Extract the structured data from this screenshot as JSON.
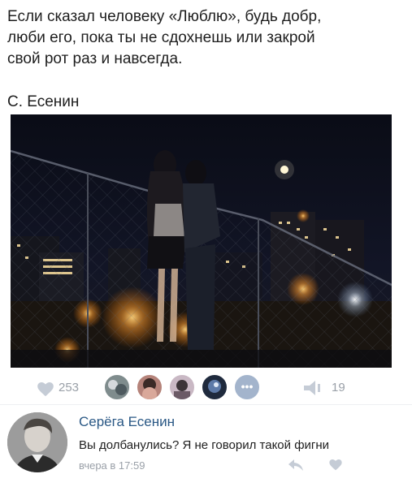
{
  "post": {
    "text_lines": [
      "Если сказал человеку «Люблю», будь добр,",
      "люби его, пока ты не сдохнешь или закрой",
      "свой рот раз и навсегда."
    ],
    "author": "С. Есенин"
  },
  "actions": {
    "like_count": "253",
    "repost_count": "19",
    "more_avatars_label": "•••"
  },
  "comment": {
    "name": "Серёга Есенин",
    "text": "Вы долбанулись? Я не говорил такой фигни",
    "time": "вчера в 17:59"
  },
  "colors": {
    "link": "#2a5885",
    "muted": "#9aa0a8",
    "icon": "#c5ccd6"
  },
  "icons": [
    "heart-icon",
    "repost-icon",
    "reply-icon",
    "comment-heart-icon"
  ]
}
